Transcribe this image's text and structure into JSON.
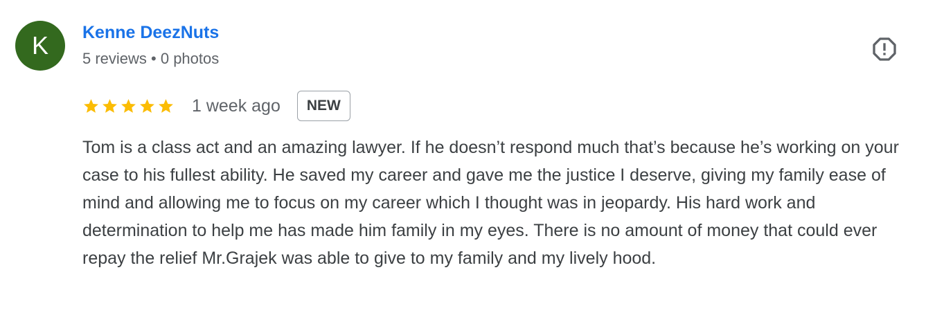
{
  "review": {
    "reviewer": {
      "initial": "K",
      "avatar_color": "#33691e",
      "name": "Kenne DeezNuts",
      "meta": "5 reviews • 0 photos"
    },
    "report_icon": "report-flag-octagon-icon",
    "rating": {
      "stars": 5,
      "max": 5,
      "star_color": "#fbbc04"
    },
    "date": "1 week ago",
    "badge": "NEW",
    "text": "Tom is a class act and an amazing lawyer. If he doesn’t respond much that’s because he’s working on your case to his fullest ability. He saved my career and gave me the justice I deserve, giving my family ease of mind and allowing me to focus on my career which I thought was in jeopardy. His hard work and determination to help me has made him family in my eyes. There is no amount of money that could ever repay the relief Mr.Grajek was able to give to my family and my lively hood."
  },
  "colors": {
    "name_link": "#1a73e8",
    "secondary_text": "#5f6368",
    "body_text": "#3c4043",
    "icon": "#5f6368"
  }
}
